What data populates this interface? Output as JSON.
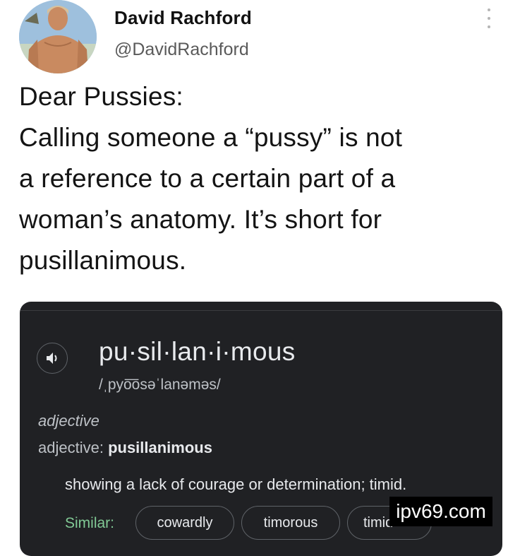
{
  "author": {
    "name": "David Rachford",
    "handle": "@DavidRachford"
  },
  "tweet_lines": [
    "Dear Pussies:",
    "Calling someone a “pussy” is not",
    "a reference to a certain part of a",
    "woman’s anatomy.  It’s short for",
    "pusillanimous."
  ],
  "dictionary": {
    "word": "pu·sil·lan·i·mous",
    "pronunciation": "/ˌpyo͞osəˈlanəməs/",
    "part_of_speech": "adjective",
    "pos_label": "adjective: ",
    "pos_value": "pusillanimous",
    "definition": "showing a lack of courage or determination; timid.",
    "similar_label": "Similar:",
    "similar": [
      "cowardly",
      "timorous",
      "timid"
    ]
  },
  "watermark": "ipv69.com",
  "colors": {
    "card_bg": "#202124",
    "similar_green": "#81c995"
  },
  "icons": {
    "more": "vertical-dots-icon",
    "speaker": "speaker-icon"
  }
}
